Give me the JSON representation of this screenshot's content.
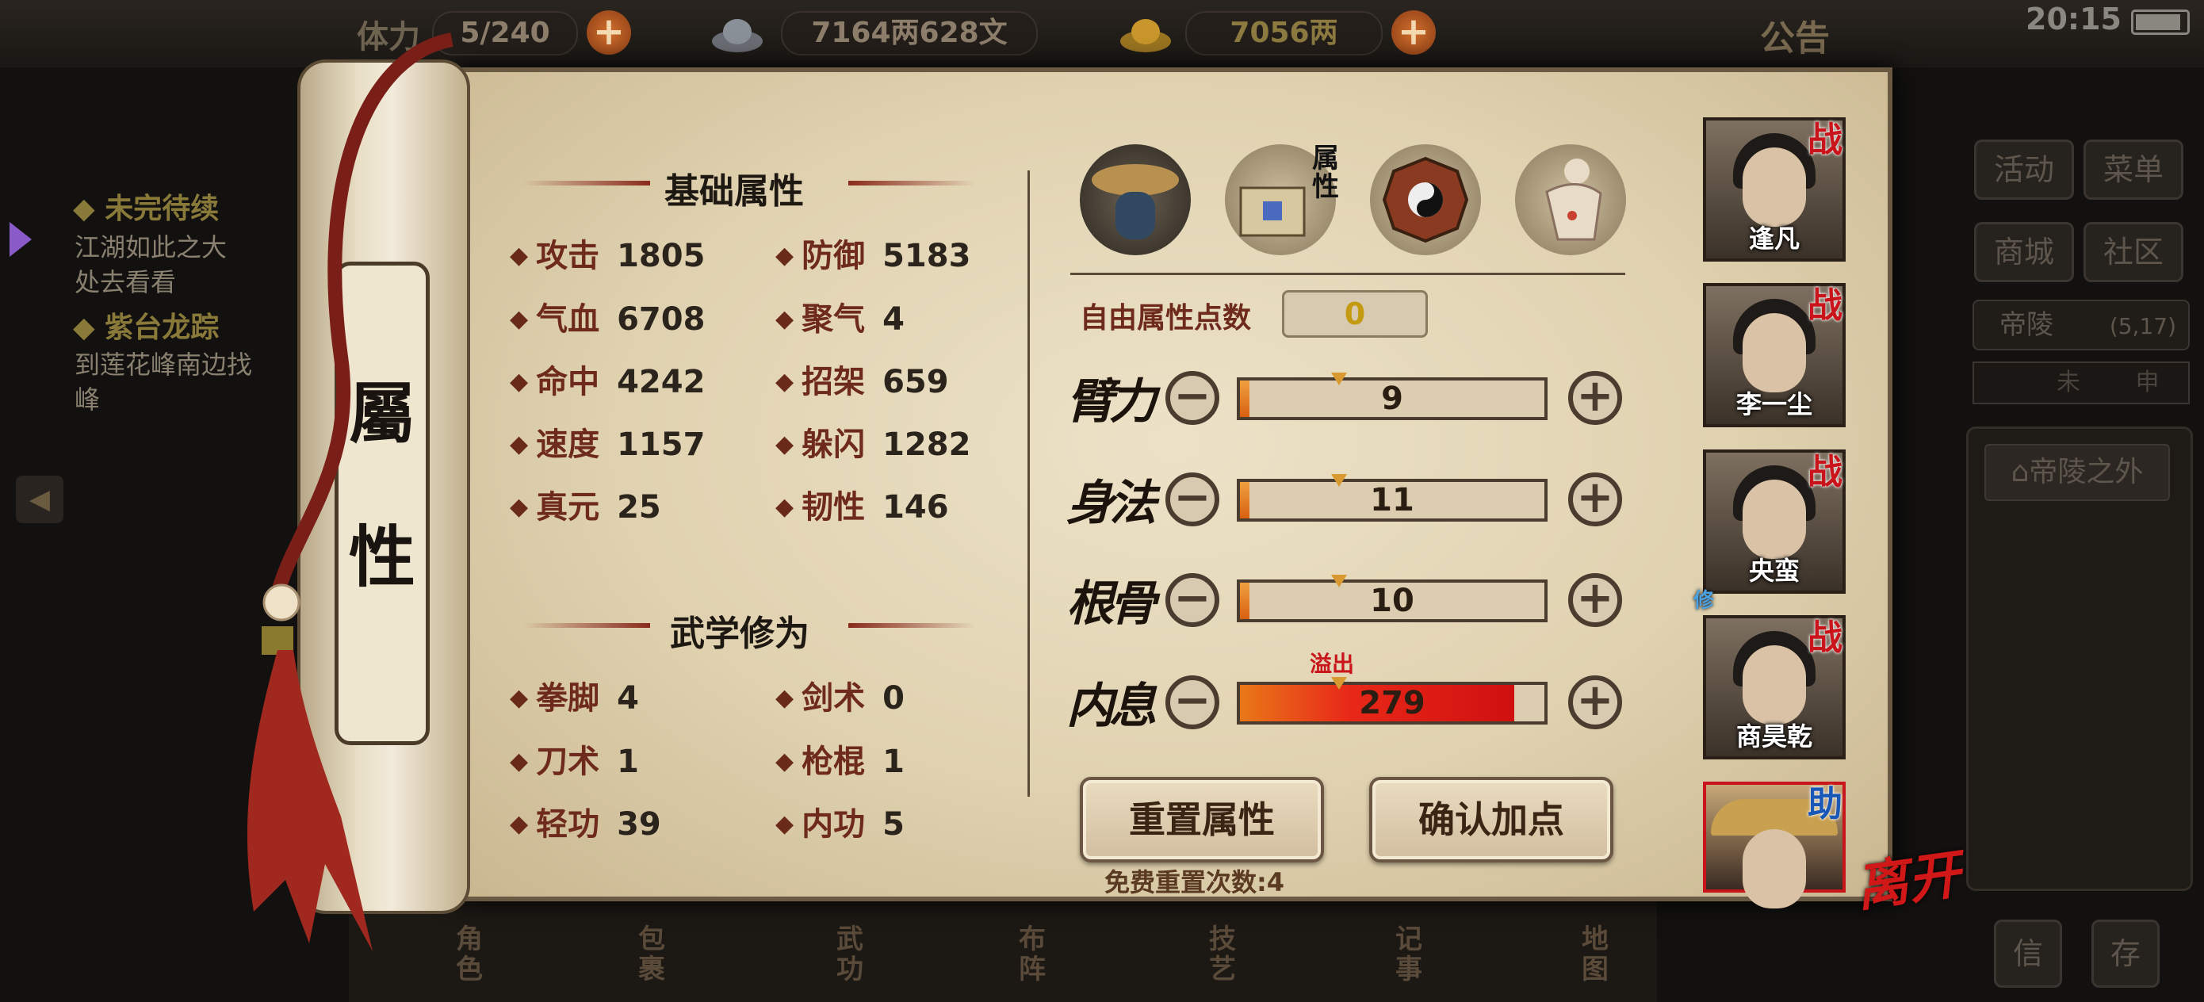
{
  "status_bar": {
    "time": "20:15"
  },
  "top_bar": {
    "stamina_label": "体力",
    "stamina_value": "5/240",
    "silver": "7164两628文",
    "gold": "7056两",
    "notice": "公告"
  },
  "quests": [
    {
      "title": "未完待续",
      "desc": [
        "江湖如此之大",
        "处去看看"
      ]
    },
    {
      "title": "紫台龙踪",
      "desc": [
        "到莲花峰南边找",
        "峰"
      ]
    }
  ],
  "scroll_label": [
    "屬",
    "性"
  ],
  "basic": {
    "title": "基础属性",
    "stats": [
      {
        "name": "攻击",
        "value": "1805"
      },
      {
        "name": "防御",
        "value": "5183"
      },
      {
        "name": "气血",
        "value": "6708"
      },
      {
        "name": "聚气",
        "value": "4"
      },
      {
        "name": "命中",
        "value": "4242"
      },
      {
        "name": "招架",
        "value": "659"
      },
      {
        "name": "速度",
        "value": "1157"
      },
      {
        "name": "躲闪",
        "value": "1282"
      },
      {
        "name": "真元",
        "value": "25"
      },
      {
        "name": "韧性",
        "value": "146"
      }
    ]
  },
  "martial": {
    "title": "武学修为",
    "stats": [
      {
        "name": "拳脚",
        "value": "4"
      },
      {
        "name": "剑术",
        "value": "0"
      },
      {
        "name": "刀术",
        "value": "1"
      },
      {
        "name": "枪棍",
        "value": "1"
      },
      {
        "name": "轻功",
        "value": "39"
      },
      {
        "name": "内功",
        "value": "5"
      }
    ]
  },
  "tabs": {
    "attr_tab_label": "属性"
  },
  "free_points": {
    "label": "自由属性点数",
    "value": "0"
  },
  "attributes": [
    {
      "label": "臂力",
      "value": "9",
      "fill": 0.03,
      "overflow": false
    },
    {
      "label": "身法",
      "value": "11",
      "fill": 0.03,
      "overflow": false
    },
    {
      "label": "根骨",
      "value": "10",
      "fill": 0.03,
      "overflow": false
    },
    {
      "label": "内息",
      "value": "279",
      "fill": 0.9,
      "overflow": true,
      "overflow_label": "溢出"
    }
  ],
  "buttons": {
    "reset": "重置属性",
    "confirm": "确认加点",
    "free_reset": "免费重置次数:4"
  },
  "party": [
    {
      "name": "逢凡",
      "tag": "战"
    },
    {
      "name": "李一尘",
      "tag": "战"
    },
    {
      "name": "央蛮",
      "tag": "战",
      "extra_tag": "修"
    },
    {
      "name": "商昊乾",
      "tag": "战"
    },
    {
      "name": "",
      "tag": "助"
    }
  ],
  "leave": "离开",
  "side_menu": {
    "buttons": [
      "活动",
      "菜单",
      "商城",
      "社区"
    ],
    "location": "帝陵",
    "coords": "(5,17)",
    "compass": [
      "未",
      "申"
    ],
    "area": "帝陵之外",
    "bottom": [
      "信",
      "存"
    ]
  },
  "bottom_nav": [
    "角色",
    "包裹",
    "武功",
    "布阵",
    "技艺",
    "记事",
    "地图"
  ],
  "colors": {
    "accent_red": "#c8141a",
    "stat_name": "#6e2a1c",
    "paper": "#e6d9bc",
    "overflow_bar": "#e02818"
  }
}
